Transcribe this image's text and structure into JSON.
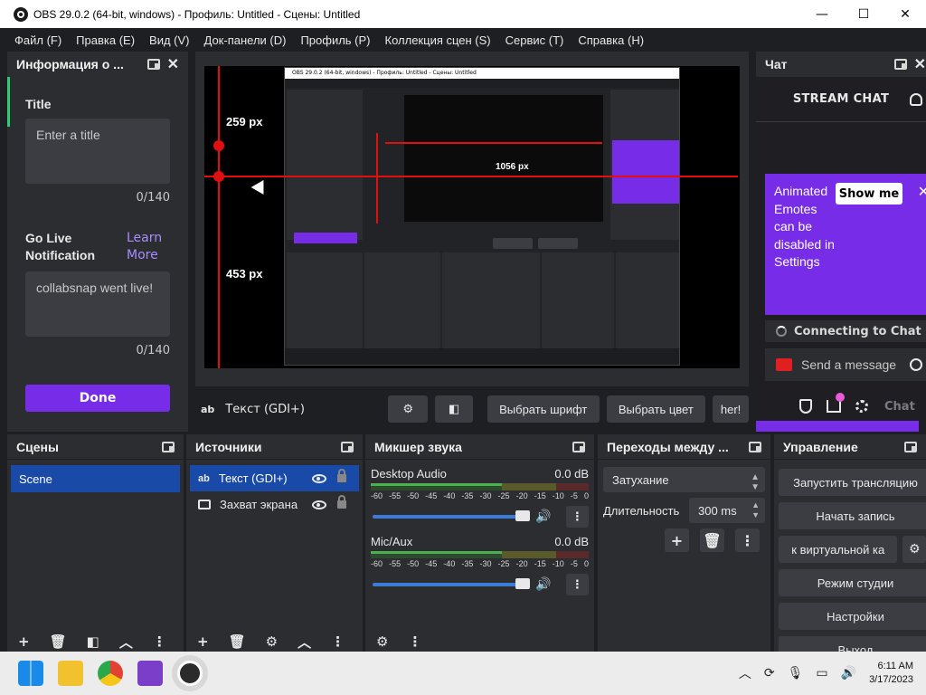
{
  "window": {
    "title": "OBS 29.0.2 (64-bit, windows) - Профиль: Untitled - Сцены: Untitled",
    "minimize": "—",
    "maximize": "☐",
    "close": "✕"
  },
  "menu": [
    "Файл (F)",
    "Правка (E)",
    "Вид (V)",
    "Док-панели (D)",
    "Профиль (P)",
    "Коллекция сцен (S)",
    "Сервис (T)",
    "Справка (H)"
  ],
  "info_dock": {
    "header": "Информация о ...",
    "title_label": "Title",
    "title_placeholder": "Enter a title",
    "title_counter": "0/140",
    "golive_label": "Go Live Notification",
    "learn_more": "Learn More",
    "golive_value": "collabsnap went live!",
    "golive_counter": "0/140",
    "done": "Done"
  },
  "preview": {
    "label_top": "259 px",
    "label_bottom": "453 px",
    "nested_width_label": "1056 px"
  },
  "text_toolbar": {
    "source_icon": "ab",
    "source_name": "Текст (GDI+)",
    "select_font": "Выбрать шрифт",
    "select_color": "Выбрать цвет",
    "text_value": "her!"
  },
  "chat": {
    "header": "Чат",
    "stream_chat": "STREAM CHAT",
    "promo_text": "Animated Emotes can be disabled in Settings",
    "show_me": "Show me",
    "connecting": "Connecting to Chat",
    "send_placeholder": "Send a message",
    "chat_button": "Chat"
  },
  "scenes": {
    "header": "Сцены",
    "items": [
      "Scene"
    ]
  },
  "sources": {
    "header": "Источники",
    "items": [
      {
        "icon": "ab",
        "name": "Текст (GDI+)"
      },
      {
        "icon": "monitor",
        "name": "Захват экрана"
      }
    ]
  },
  "mixer": {
    "header": "Микшер звука",
    "scale": [
      "-60",
      "-55",
      "-50",
      "-45",
      "-40",
      "-35",
      "-30",
      "-25",
      "-20",
      "-15",
      "-10",
      "-5",
      "0"
    ],
    "channels": [
      {
        "name": "Desktop Audio",
        "db": "0.0 dB"
      },
      {
        "name": "Mic/Aux",
        "db": "0.0 dB"
      }
    ]
  },
  "transitions": {
    "header": "Переходы между ...",
    "selected": "Затухание",
    "duration_label": "Длительность",
    "duration_value": "300 ms"
  },
  "controls": {
    "header": "Управление",
    "start_stream": "Запустить трансляцию",
    "start_record": "Начать запись",
    "virtual_cam": "к виртуальной ка",
    "studio_mode": "Режим студии",
    "settings": "Настройки",
    "exit": "Выход"
  },
  "taskbar": {
    "time": "6:11 AM",
    "date": "3/17/2023"
  }
}
